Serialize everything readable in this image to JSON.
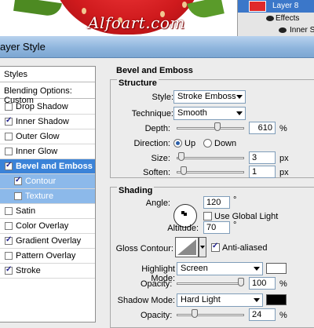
{
  "canvas": {
    "watermark": "Alfoart.com"
  },
  "layers_panel": {
    "active_layer": "Layer 8",
    "effects_label": "Effects",
    "effect_item": "Inner Shadow"
  },
  "dialog": {
    "title": "ayer Style"
  },
  "styles": {
    "header": "Styles",
    "blending": "Blending Options: Custom",
    "items": [
      {
        "label": "Drop Shadow",
        "checked": false
      },
      {
        "label": "Inner Shadow",
        "checked": true
      },
      {
        "label": "Outer Glow",
        "checked": false
      },
      {
        "label": "Inner Glow",
        "checked": false
      },
      {
        "label": "Bevel and Emboss",
        "checked": true
      },
      {
        "label": "Contour",
        "checked": true
      },
      {
        "label": "Texture",
        "checked": false
      },
      {
        "label": "Satin",
        "checked": false
      },
      {
        "label": "Color Overlay",
        "checked": false
      },
      {
        "label": "Gradient Overlay",
        "checked": true
      },
      {
        "label": "Pattern Overlay",
        "checked": false
      },
      {
        "label": "Stroke",
        "checked": true
      }
    ]
  },
  "bevel": {
    "section_title": "Bevel and Emboss",
    "structure_title": "Structure",
    "style_label": "Style:",
    "style_value": "Stroke Emboss",
    "technique_label": "Technique:",
    "technique_value": "Smooth",
    "depth_label": "Depth:",
    "depth_value": "610",
    "depth_unit": "%",
    "depth_level": 0.61,
    "direction_label": "Direction:",
    "direction_up": "Up",
    "direction_down": "Down",
    "size_label": "Size:",
    "size_value": "3",
    "size_unit": "px",
    "size_level": 0.02,
    "soften_label": "Soften:",
    "soften_value": "1",
    "soften_unit": "px",
    "soften_level": 0.06
  },
  "shading": {
    "title": "Shading",
    "angle_label": "Angle:",
    "angle_value": "120",
    "angle_unit": "°",
    "global_light_label": "Use Global Light",
    "altitude_label": "Altitude:",
    "altitude_value": "70",
    "altitude_unit": "°",
    "gloss_label": "Gloss Contour:",
    "antialiased_label": "Anti-aliased",
    "highlight_label": "Highlight Mode:",
    "highlight_value": "Screen",
    "highlight_color": "#ffffff",
    "opacity1_label": "Opacity:",
    "opacity1_value": "100",
    "opacity1_unit": "%",
    "shadow_label": "Shadow Mode:",
    "shadow_value": "Hard Light",
    "shadow_color": "#000000",
    "opacity2_label": "Opacity:",
    "opacity2_value": "24",
    "opacity2_unit": "%"
  }
}
